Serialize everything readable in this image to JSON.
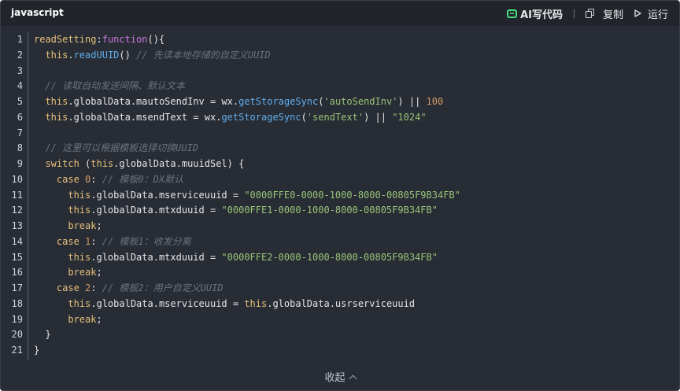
{
  "header": {
    "language": "javascript",
    "ai_label": "AI写代码",
    "copy_label": "复制",
    "run_label": "运行"
  },
  "code": {
    "lines": [
      [
        {
          "t": "readSetting",
          "c": "kw"
        },
        {
          "t": ":",
          "c": "plain"
        },
        {
          "t": "function",
          "c": "keyword2"
        },
        {
          "t": "(){",
          "c": "plain"
        }
      ],
      [
        {
          "t": "  this",
          "c": "kw"
        },
        {
          "t": ".",
          "c": "plain"
        },
        {
          "t": "readUUID",
          "c": "fn"
        },
        {
          "t": "() ",
          "c": "plain"
        },
        {
          "t": "// 先读本地存储的自定义UUID",
          "c": "cm"
        }
      ],
      [],
      [
        {
          "t": "  // 读取自动发送间隔、默认文本",
          "c": "cm"
        }
      ],
      [
        {
          "t": "  this",
          "c": "kw"
        },
        {
          "t": ".globalData.mautoSendInv = wx.",
          "c": "plain"
        },
        {
          "t": "getStorageSync",
          "c": "fn"
        },
        {
          "t": "(",
          "c": "plain"
        },
        {
          "t": "'autoSendInv'",
          "c": "str"
        },
        {
          "t": ") || ",
          "c": "plain"
        },
        {
          "t": "100",
          "c": "num"
        }
      ],
      [
        {
          "t": "  this",
          "c": "kw"
        },
        {
          "t": ".globalData.msendText = wx.",
          "c": "plain"
        },
        {
          "t": "getStorageSync",
          "c": "fn"
        },
        {
          "t": "(",
          "c": "plain"
        },
        {
          "t": "'sendText'",
          "c": "str"
        },
        {
          "t": ") || ",
          "c": "plain"
        },
        {
          "t": "\"1024\"",
          "c": "str"
        }
      ],
      [],
      [
        {
          "t": "  // 这里可以根据模板选择切换UUID",
          "c": "cm"
        }
      ],
      [
        {
          "t": "  switch",
          "c": "kw"
        },
        {
          "t": " (",
          "c": "plain"
        },
        {
          "t": "this",
          "c": "kw"
        },
        {
          "t": ".globalData.muuidSel) {",
          "c": "plain"
        }
      ],
      [
        {
          "t": "    case",
          "c": "kw"
        },
        {
          "t": " ",
          "c": "plain"
        },
        {
          "t": "0",
          "c": "num"
        },
        {
          "t": ": ",
          "c": "plain"
        },
        {
          "t": "// 模板0：DX默认",
          "c": "cm"
        }
      ],
      [
        {
          "t": "      this",
          "c": "kw"
        },
        {
          "t": ".globalData.mserviceuuid = ",
          "c": "plain"
        },
        {
          "t": "\"0000FFE0-0000-1000-8000-00805F9B34FB\"",
          "c": "str"
        }
      ],
      [
        {
          "t": "      this",
          "c": "kw"
        },
        {
          "t": ".globalData.mtxduuid = ",
          "c": "plain"
        },
        {
          "t": "\"0000FFE1-0000-1000-8000-00805F9B34FB\"",
          "c": "str"
        }
      ],
      [
        {
          "t": "      break",
          "c": "kw"
        },
        {
          "t": ";",
          "c": "plain"
        }
      ],
      [
        {
          "t": "    case",
          "c": "kw"
        },
        {
          "t": " ",
          "c": "plain"
        },
        {
          "t": "1",
          "c": "num"
        },
        {
          "t": ": ",
          "c": "plain"
        },
        {
          "t": "// 模板1：收发分离",
          "c": "cm"
        }
      ],
      [
        {
          "t": "      this",
          "c": "kw"
        },
        {
          "t": ".globalData.mtxduuid = ",
          "c": "plain"
        },
        {
          "t": "\"0000FFE2-0000-1000-8000-00805F9B34FB\"",
          "c": "str"
        }
      ],
      [
        {
          "t": "      break",
          "c": "kw"
        },
        {
          "t": ";",
          "c": "plain"
        }
      ],
      [
        {
          "t": "    case",
          "c": "kw"
        },
        {
          "t": " ",
          "c": "plain"
        },
        {
          "t": "2",
          "c": "num"
        },
        {
          "t": ": ",
          "c": "plain"
        },
        {
          "t": "// 模板2：用户自定义UUID",
          "c": "cm"
        }
      ],
      [
        {
          "t": "      this",
          "c": "kw"
        },
        {
          "t": ".globalData.mserviceuuid = ",
          "c": "plain"
        },
        {
          "t": "this",
          "c": "kw"
        },
        {
          "t": ".globalData.usrserviceuuid",
          "c": "plain"
        }
      ],
      [
        {
          "t": "      break",
          "c": "kw"
        },
        {
          "t": ";",
          "c": "plain"
        }
      ],
      [
        {
          "t": "  }",
          "c": "plain"
        }
      ],
      [
        {
          "t": "}",
          "c": "plain"
        }
      ]
    ],
    "line_numbers": [
      "1",
      "2",
      "3",
      "4",
      "5",
      "6",
      "7",
      "8",
      "9",
      "10",
      "11",
      "12",
      "13",
      "14",
      "15",
      "16",
      "17",
      "18",
      "19",
      "20",
      "21"
    ]
  },
  "footer": {
    "collapse_label": "收起"
  },
  "colors": {
    "background": "#282c34",
    "header": "#21252b",
    "ai_icon": "#4ade80"
  },
  "icons": [
    "ai-robot-icon",
    "copy-icon",
    "run-play-icon",
    "chevron-up-icon"
  ]
}
